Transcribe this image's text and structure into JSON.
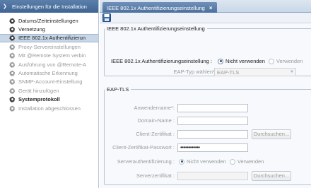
{
  "sidebar": {
    "header": "Einstellungen für die Installation",
    "items": [
      {
        "label": "Datums/Zeiteinstellungen",
        "state": "normal"
      },
      {
        "label": "Vernetzung",
        "state": "normal"
      },
      {
        "label": "IEEE 802.1x Authentifizierun",
        "state": "selected"
      },
      {
        "label": "Proxy-Servereinstellungen",
        "state": "disabled"
      },
      {
        "label": "Mit @Remote System verbin",
        "state": "disabled"
      },
      {
        "label": "Ausführung von @Remote-A",
        "state": "disabled"
      },
      {
        "label": "Automatische Erkennung",
        "state": "disabled"
      },
      {
        "label": "SNMP-Account-Einstellung",
        "state": "disabled"
      },
      {
        "label": "Gerät hinzufügen",
        "state": "disabled"
      },
      {
        "label": "Systemprotokoll",
        "state": "bold"
      },
      {
        "label": "Installation abgeschlossen",
        "state": "disabled"
      }
    ]
  },
  "tab": {
    "label": "IEEE 802.1x Authentifizierungseinstellung",
    "close": "×"
  },
  "ieee_group": {
    "legend": "IEEE 802.1x Authentifizierungseinstellung",
    "auth_label": "IEEE 802.1x Authentifizierungseinstellung :",
    "opt_off": "Nicht verwenden",
    "opt_on": "Verwenden",
    "selected": "Nicht verwenden",
    "eap_type_label": "EAP-Typ wählen*:",
    "eap_type_value": "EAP-TLS"
  },
  "eap_group": {
    "legend": "EAP-TLS",
    "username_label": "Anwendername*:",
    "domain_label": "Domain-Name :",
    "client_cert_label": "Client-Zertifikat :",
    "client_cert_pw_label": "Client-Zertifikat-Passwort :",
    "password_value": "••••••••••••",
    "server_auth_label": "Serverauthentifizierung :",
    "server_auth_off": "Nicht verwenden",
    "server_auth_on": "Verwenden",
    "server_cert_label": "Serverzertifikat :",
    "browse_label": "Durchsuchen..."
  },
  "colors": {
    "accent": "#4a6f9c",
    "selected_bg": "#c8d7e8"
  }
}
